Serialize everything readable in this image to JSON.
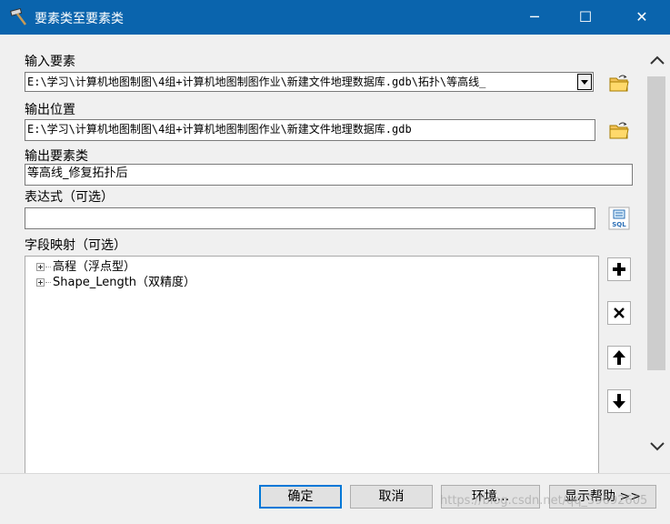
{
  "window": {
    "title": "要素类至要素类",
    "minimize_glyph": "─",
    "maximize_glyph": "☐",
    "close_glyph": "✕"
  },
  "input_features": {
    "label": "输入要素",
    "value": "E:\\学习\\计算机地图制图\\4组+计算机地图制图作业\\新建文件地理数据库.gdb\\拓扑\\等高线_"
  },
  "output_location": {
    "label": "输出位置",
    "value": "E:\\学习\\计算机地图制图\\4组+计算机地图制图作业\\新建文件地理数据库.gdb"
  },
  "output_feature_class": {
    "label": "输出要素类",
    "value": "等高线_修复拓扑后"
  },
  "expression": {
    "label": "表达式（可选）",
    "value": ""
  },
  "field_map": {
    "label": "字段映射（可选）",
    "items": [
      {
        "label": "高程（浮点型）"
      },
      {
        "label": "Shape_Length（双精度）"
      }
    ]
  },
  "buttons": {
    "ok": "确定",
    "cancel": "取消",
    "environments": "环境...",
    "show_help": "显示帮助 >>"
  },
  "watermark": "https://blog.csdn.net/qq_39692605",
  "colors": {
    "titlebar": "#0a64ad",
    "default_button_border": "#0078d7"
  },
  "icons": [
    "hammer-icon",
    "open-folder-icon",
    "sql-icon",
    "add-icon",
    "remove-icon",
    "up-arrow-icon",
    "down-arrow-icon",
    "chevron-up-icon",
    "chevron-down-icon"
  ]
}
